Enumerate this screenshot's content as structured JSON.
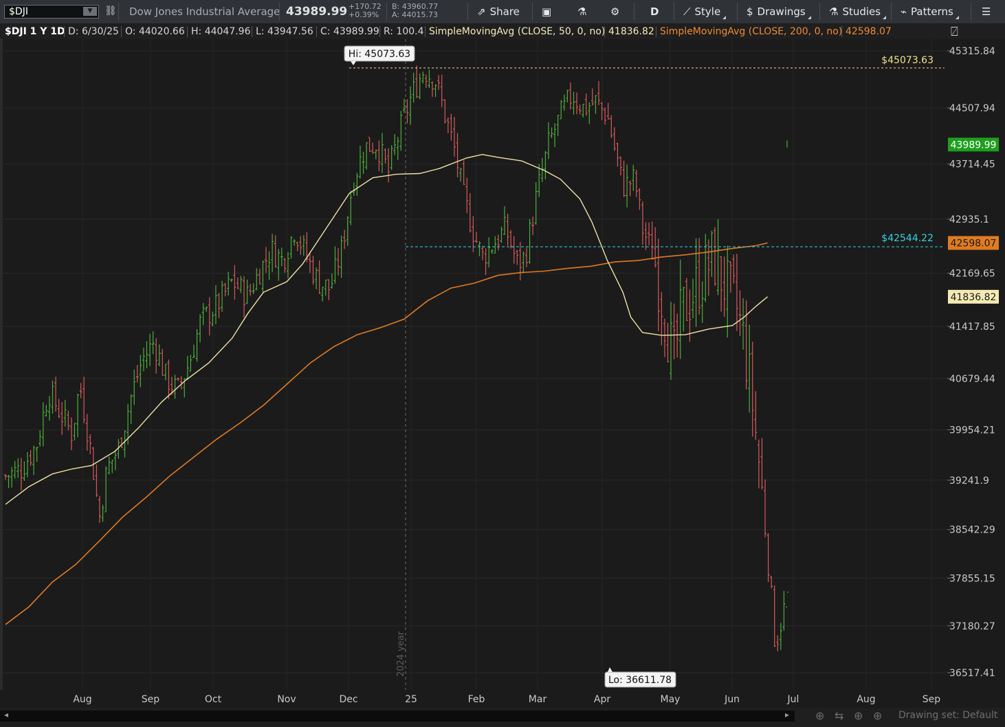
{
  "toolbar": {
    "symbol": "$DJI",
    "description": "Dow Jones Industrial Average",
    "last": "43989.99",
    "net_change": "+170.72",
    "pct_change": "+0.39%",
    "bid": "B: 43960.77",
    "ask": "A: 44015.73",
    "share": "Share",
    "aggregation": "D",
    "style": "Style",
    "drawings": "Drawings",
    "studies": "Studies",
    "patterns": "Patterns",
    "icons": [
      "link-icon",
      "share-icon",
      "snapshot-icon",
      "flask-icon",
      "gear-icon",
      "style-icon",
      "drawings-icon",
      "studies-icon",
      "patterns-icon",
      "menu-icon"
    ]
  },
  "infobar": {
    "title": "$DJI 1 Y 1D",
    "date": "D: 6/30/25",
    "open": "O: 44020.66",
    "high": "H: 44047.96",
    "low": "L: 43947.56",
    "close": "C: 43989.99",
    "range": "R: 100.4",
    "sma50_label": "SimpleMovingAvg (CLOSE, 50, 0, no)",
    "sma50_value": "41836.82",
    "sma200_label": "SimpleMovingAvg (CLOSE, 200, 0, no)",
    "sma200_value": "42598.07"
  },
  "footer": {
    "drawing_set": "Drawing set: Default"
  },
  "chart_data": {
    "type": "ohlc",
    "symbol": "$DJI",
    "aggregation": "1 Y 1D",
    "y_ticks": [
      45315.84,
      44507.94,
      43714.45,
      42935.1,
      42169.65,
      41417.85,
      40679.44,
      39954.21,
      39241.9,
      38542.29,
      37855.15,
      37180.27,
      36517.41
    ],
    "x_ticks": [
      "Aug",
      "Sep",
      "Oct",
      "Nov",
      "Dec",
      "25",
      "Feb",
      "Mar",
      "Apr",
      "May",
      "Jun",
      "Jul",
      "Aug",
      "Sep"
    ],
    "year_marker": "2024 year",
    "colors": {
      "up": "#4caf3b",
      "down": "#d85a5a",
      "sma50": "#efe3a6",
      "sma200": "#e07b22",
      "hi_line": "#f0e08a",
      "level_line": "#38d0e0",
      "last_tag": "#1e9e1e"
    },
    "annotations": {
      "high": {
        "label": "Hi: 45073.63",
        "value": 45073.63
      },
      "low": {
        "label": "Lo: 36611.78",
        "value": 36611.78
      },
      "hi_line_label": "$45073.63",
      "level_line_label": "$42544.22",
      "level_line_value": 42544.22
    },
    "price_tags": {
      "last": "43989.99",
      "sma200": "42598.07",
      "sma50": "41836.82"
    },
    "sma50_curve": [
      [
        0,
        38900
      ],
      [
        0.03,
        39150
      ],
      [
        0.06,
        39330
      ],
      [
        0.085,
        39400
      ],
      [
        0.11,
        39450
      ],
      [
        0.14,
        39650
      ],
      [
        0.17,
        39980
      ],
      [
        0.2,
        40350
      ],
      [
        0.23,
        40650
      ],
      [
        0.26,
        40900
      ],
      [
        0.29,
        41250
      ],
      [
        0.31,
        41600
      ],
      [
        0.33,
        41900
      ],
      [
        0.36,
        42050
      ],
      [
        0.38,
        42300
      ],
      [
        0.41,
        42800
      ],
      [
        0.44,
        43300
      ],
      [
        0.47,
        43520
      ],
      [
        0.5,
        43570
      ],
      [
        0.53,
        43580
      ],
      [
        0.555,
        43650
      ],
      [
        0.59,
        43800
      ],
      [
        0.61,
        43850
      ],
      [
        0.63,
        43810
      ],
      [
        0.66,
        43760
      ],
      [
        0.69,
        43620
      ],
      [
        0.71,
        43500
      ],
      [
        0.735,
        43220
      ],
      [
        0.75,
        42900
      ],
      [
        0.77,
        42350
      ],
      [
        0.79,
        41900
      ],
      [
        0.8,
        41550
      ],
      [
        0.815,
        41330
      ],
      [
        0.84,
        41290
      ],
      [
        0.87,
        41300
      ],
      [
        0.9,
        41380
      ],
      [
        0.93,
        41430
      ],
      [
        0.945,
        41550
      ],
      [
        0.96,
        41700
      ],
      [
        0.975,
        41836.82
      ]
    ],
    "sma200_curve": [
      [
        0,
        37200
      ],
      [
        0.03,
        37450
      ],
      [
        0.06,
        37800
      ],
      [
        0.09,
        38050
      ],
      [
        0.12,
        38380
      ],
      [
        0.15,
        38720
      ],
      [
        0.18,
        39000
      ],
      [
        0.21,
        39300
      ],
      [
        0.24,
        39560
      ],
      [
        0.27,
        39820
      ],
      [
        0.3,
        40050
      ],
      [
        0.33,
        40300
      ],
      [
        0.36,
        40600
      ],
      [
        0.39,
        40900
      ],
      [
        0.42,
        41130
      ],
      [
        0.45,
        41300
      ],
      [
        0.48,
        41400
      ],
      [
        0.51,
        41520
      ],
      [
        0.54,
        41780
      ],
      [
        0.57,
        41960
      ],
      [
        0.6,
        42030
      ],
      [
        0.63,
        42140
      ],
      [
        0.66,
        42180
      ],
      [
        0.69,
        42200
      ],
      [
        0.72,
        42240
      ],
      [
        0.75,
        42270
      ],
      [
        0.78,
        42330
      ],
      [
        0.81,
        42350
      ],
      [
        0.84,
        42400
      ],
      [
        0.87,
        42430
      ],
      [
        0.9,
        42470
      ],
      [
        0.93,
        42520
      ],
      [
        0.96,
        42560
      ],
      [
        0.975,
        42598.07
      ]
    ],
    "close_path": [
      [
        0,
        39300
      ],
      [
        0.02,
        39400
      ],
      [
        0.04,
        39750
      ],
      [
        0.055,
        40500
      ],
      [
        0.07,
        40200
      ],
      [
        0.085,
        39900
      ],
      [
        0.095,
        40600
      ],
      [
        0.11,
        39600
      ],
      [
        0.12,
        38700
      ],
      [
        0.13,
        39400
      ],
      [
        0.145,
        39700
      ],
      [
        0.16,
        40400
      ],
      [
        0.175,
        40950
      ],
      [
        0.19,
        41200
      ],
      [
        0.205,
        40700
      ],
      [
        0.22,
        40500
      ],
      [
        0.235,
        40900
      ],
      [
        0.25,
        41500
      ],
      [
        0.27,
        41700
      ],
      [
        0.29,
        42050
      ],
      [
        0.31,
        41850
      ],
      [
        0.325,
        42200
      ],
      [
        0.34,
        42500
      ],
      [
        0.355,
        42350
      ],
      [
        0.37,
        42800
      ],
      [
        0.385,
        42400
      ],
      [
        0.4,
        42050
      ],
      [
        0.415,
        41950
      ],
      [
        0.43,
        42500
      ],
      [
        0.445,
        43500
      ],
      [
        0.46,
        43950
      ],
      [
        0.475,
        44000
      ],
      [
        0.49,
        43600
      ],
      [
        0.505,
        44200
      ],
      [
        0.52,
        44700
      ],
      [
        0.535,
        45050
      ],
      [
        0.55,
        44900
      ],
      [
        0.56,
        44500
      ],
      [
        0.575,
        43900
      ],
      [
        0.585,
        43300
      ],
      [
        0.6,
        42700
      ],
      [
        0.61,
        42400
      ],
      [
        0.625,
        42600
      ],
      [
        0.64,
        42800
      ],
      [
        0.655,
        42300
      ],
      [
        0.665,
        42400
      ],
      [
        0.68,
        43300
      ],
      [
        0.695,
        44000
      ],
      [
        0.71,
        44400
      ],
      [
        0.725,
        44700
      ],
      [
        0.74,
        44500
      ],
      [
        0.755,
        44600
      ],
      [
        0.77,
        44400
      ],
      [
        0.78,
        43900
      ],
      [
        0.79,
        43400
      ],
      [
        0.805,
        43500
      ],
      [
        0.815,
        42800
      ],
      [
        0.83,
        42400
      ],
      [
        0.845,
        41500
      ],
      [
        0.855,
        40900
      ],
      [
        0.865,
        41600
      ],
      [
        0.88,
        41900
      ],
      [
        0.895,
        42200
      ],
      [
        0.905,
        42400
      ],
      [
        0.92,
        42000
      ],
      [
        0.935,
        41700
      ],
      [
        0.945,
        41200
      ],
      [
        0.955,
        40400
      ],
      [
        0.965,
        39400
      ],
      [
        0.975,
        38200
      ],
      [
        0.985,
        36900
      ],
      [
        1.0,
        37600
      ]
    ]
  }
}
